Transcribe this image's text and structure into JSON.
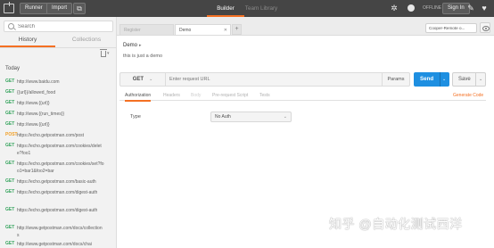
{
  "topbar": {
    "runner_label": "Runner",
    "import_label": "Import",
    "tabs": [
      {
        "label": "Builder",
        "active": true
      },
      {
        "label": "Team Library",
        "active": false
      }
    ],
    "offline_label": "OFFLINE",
    "signin_label": "Sign In",
    "icons": [
      "new-window-icon",
      "satellite-icon",
      "sync-icon",
      "wrench-icon",
      "bell-icon",
      "heart-icon"
    ]
  },
  "sidebar": {
    "search_placeholder": "Search",
    "tabs": [
      {
        "label": "History",
        "active": true
      },
      {
        "label": "Collections",
        "active": false
      }
    ],
    "group_label": "Today",
    "items": [
      {
        "method": "GET",
        "url": "http://www.baidu.com"
      },
      {
        "method": "GET",
        "url": "{{url}}/allowed_food"
      },
      {
        "method": "GET",
        "url": "http://www.{{url}}"
      },
      {
        "method": "GET",
        "url": "http://www.{{run_times}}"
      },
      {
        "method": "GET",
        "url": "http://www.{{url}}"
      },
      {
        "method": "POST",
        "url": "https://echo.getpostman.com/post"
      },
      {
        "method": "GET",
        "url": "https://echo.getpostman.com/cookies/delete?foo1"
      },
      {
        "method": "GET",
        "url": "https://echo.getpostman.com/cookies/set?foo1=bar1&foo2=bar"
      },
      {
        "method": "GET",
        "url": "https://echo.getpostman.com/basic-auth"
      },
      {
        "method": "GET",
        "url": "https://echo.getpostman.com/digest-auth"
      },
      {
        "method": "GET",
        "url": "https://echo.getpostman.com/digest-auth"
      },
      {
        "method": "GET",
        "url": "http://www.getpostman.com/docs/collections"
      },
      {
        "method": "GET",
        "url": "http://www.getpostman.com/docs/chai"
      }
    ]
  },
  "request_tabs": {
    "tabs": [
      {
        "label": "Register",
        "active": false
      },
      {
        "label": "Demo",
        "active": true
      }
    ],
    "add_label": "+",
    "environment_label": "Cooper-Remote o..."
  },
  "request": {
    "name": "Demo",
    "description": "this is just a demo",
    "method": "GET",
    "url_placeholder": "Enter request URL",
    "params_label": "Params",
    "send_label": "Send",
    "save_label": "Save",
    "subtabs": [
      {
        "label": "Authorization",
        "state": "active"
      },
      {
        "label": "Headers",
        "state": "inactive"
      },
      {
        "label": "Body",
        "state": "disabled"
      },
      {
        "label": "Pre-request Script",
        "state": "inactive"
      },
      {
        "label": "Tests",
        "state": "inactive"
      }
    ],
    "generate_code_label": "Generate Code",
    "auth_type_label": "Type",
    "auth_type_value": "No Auth"
  },
  "watermark": "知乎 @自动化测试西洋",
  "colors": {
    "accent": "#f47023",
    "send_blue": "#1e8fe1",
    "get_green": "#35a45d",
    "post_orange": "#f29f24",
    "topbar": "#454545"
  }
}
